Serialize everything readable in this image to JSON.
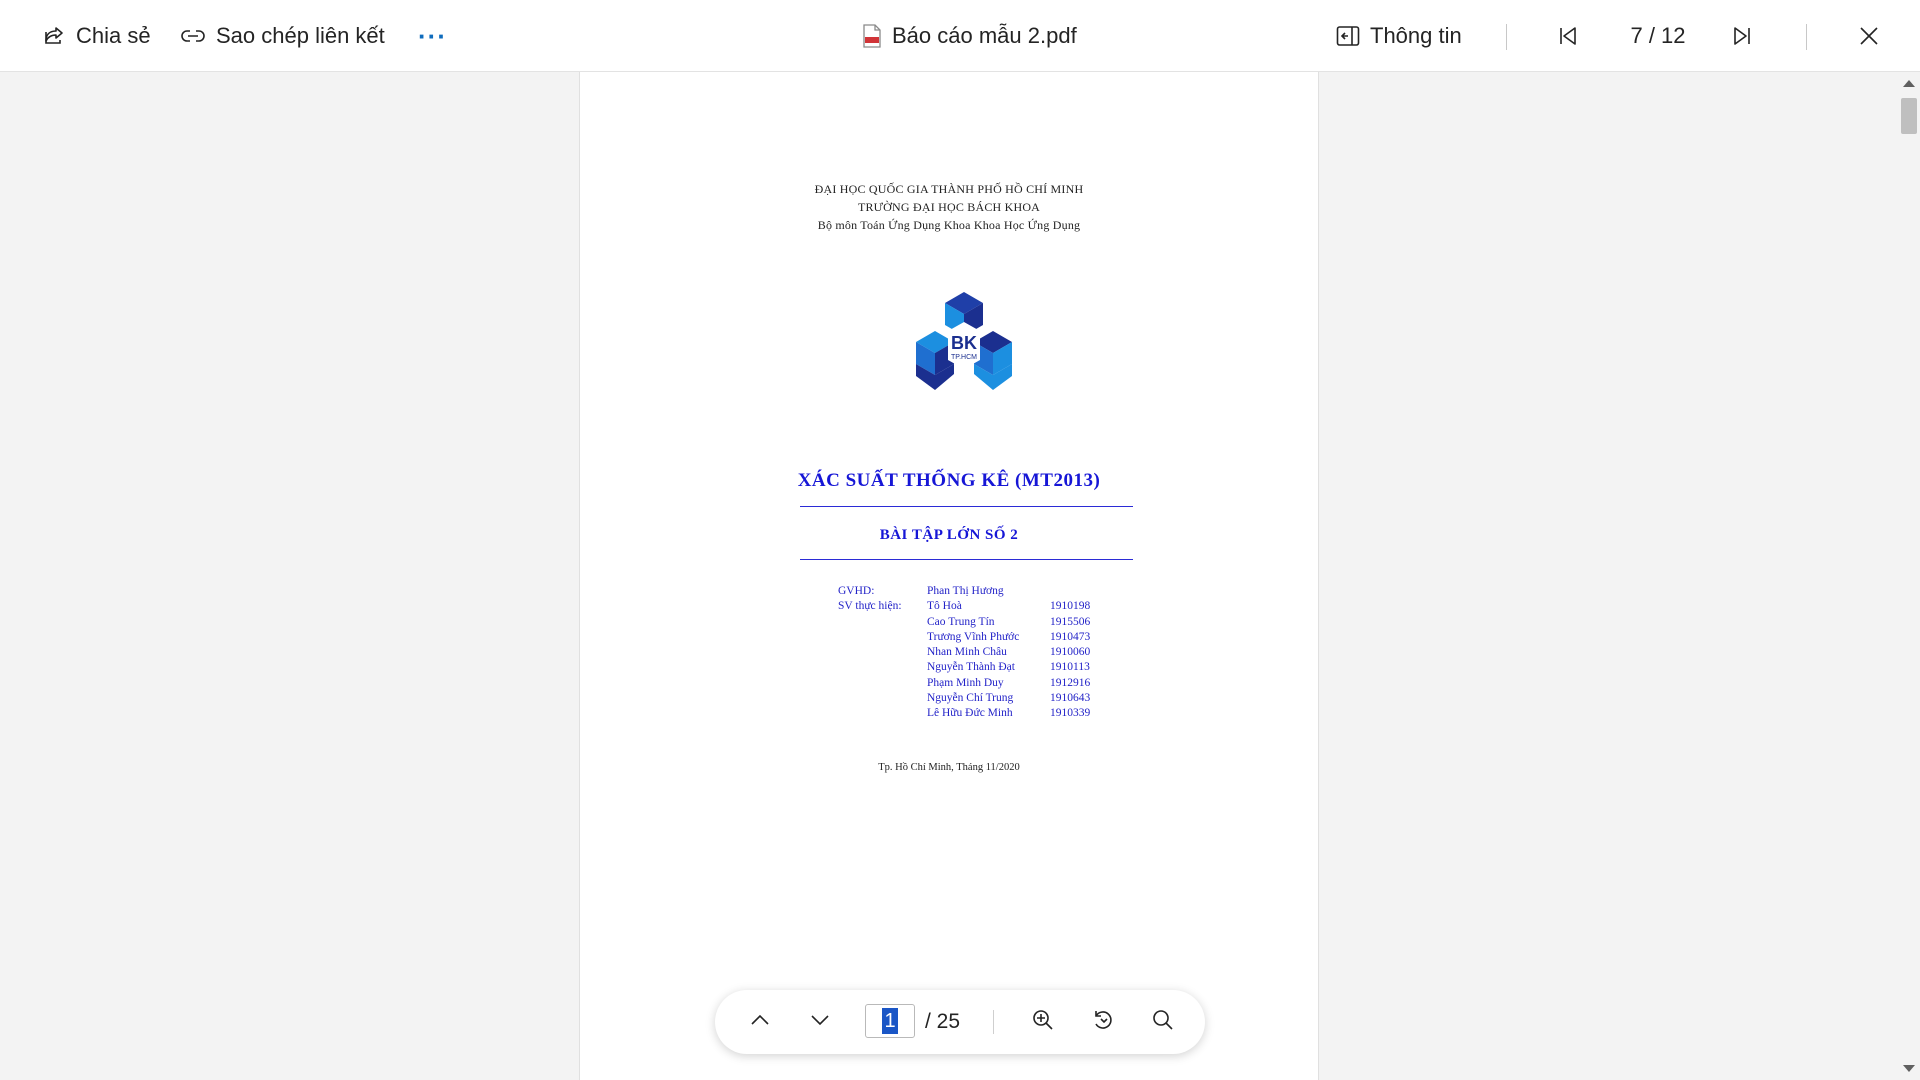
{
  "toolbar": {
    "share_label": "Chia sẻ",
    "copy_link_label": "Sao chép liên kết",
    "more_label": "···",
    "file_title": "Báo cáo mẫu 2.pdf",
    "info_label": "Thông tin",
    "page_indicator": "7 / 12"
  },
  "document": {
    "header_line1": "ĐẠI HỌC QUỐC GIA THÀNH PHỐ HỒ CHÍ MINH",
    "header_line2": "TRƯỜNG ĐẠI HỌC BÁCH KHOA",
    "header_line3": "Bộ môn Toán Ứng Dụng Khoa Khoa Học Ứng Dụng",
    "logo_text": "BK",
    "logo_subtext": "TP.HCM",
    "title": "XÁC SUẤT THỐNG KÊ (MT2013)",
    "subtitle": "BÀI TẬP LỚN SỐ 2",
    "supervisor_label": "GVHD:",
    "supervisor_name": "Phan Thị Hương",
    "students_label": "SV thực hiện:",
    "students": [
      {
        "name": "Tô Hoà",
        "id": "1910198"
      },
      {
        "name": "Cao Trung Tín",
        "id": "1915506"
      },
      {
        "name": "Trương Vĩnh Phước",
        "id": "1910473"
      },
      {
        "name": "Nhan Minh Châu",
        "id": "1910060"
      },
      {
        "name": "Nguyễn Thành Đạt",
        "id": "1910113"
      },
      {
        "name": "Phạm Minh Duy",
        "id": "1912916"
      },
      {
        "name": "Nguyễn Chí Trung",
        "id": "1910643"
      },
      {
        "name": "Lê Hữu Đức Minh",
        "id": "1910339"
      }
    ],
    "date_line": "Tp. Hồ Chí Minh, Tháng 11/2020"
  },
  "page_nav": {
    "current_page": "1",
    "total": "/ 25"
  },
  "colors": {
    "accent": "#0f6cbd",
    "doc_blue": "#1616d6",
    "logo_dark": "#1b2f8f",
    "logo_light": "#1c8fe0"
  }
}
